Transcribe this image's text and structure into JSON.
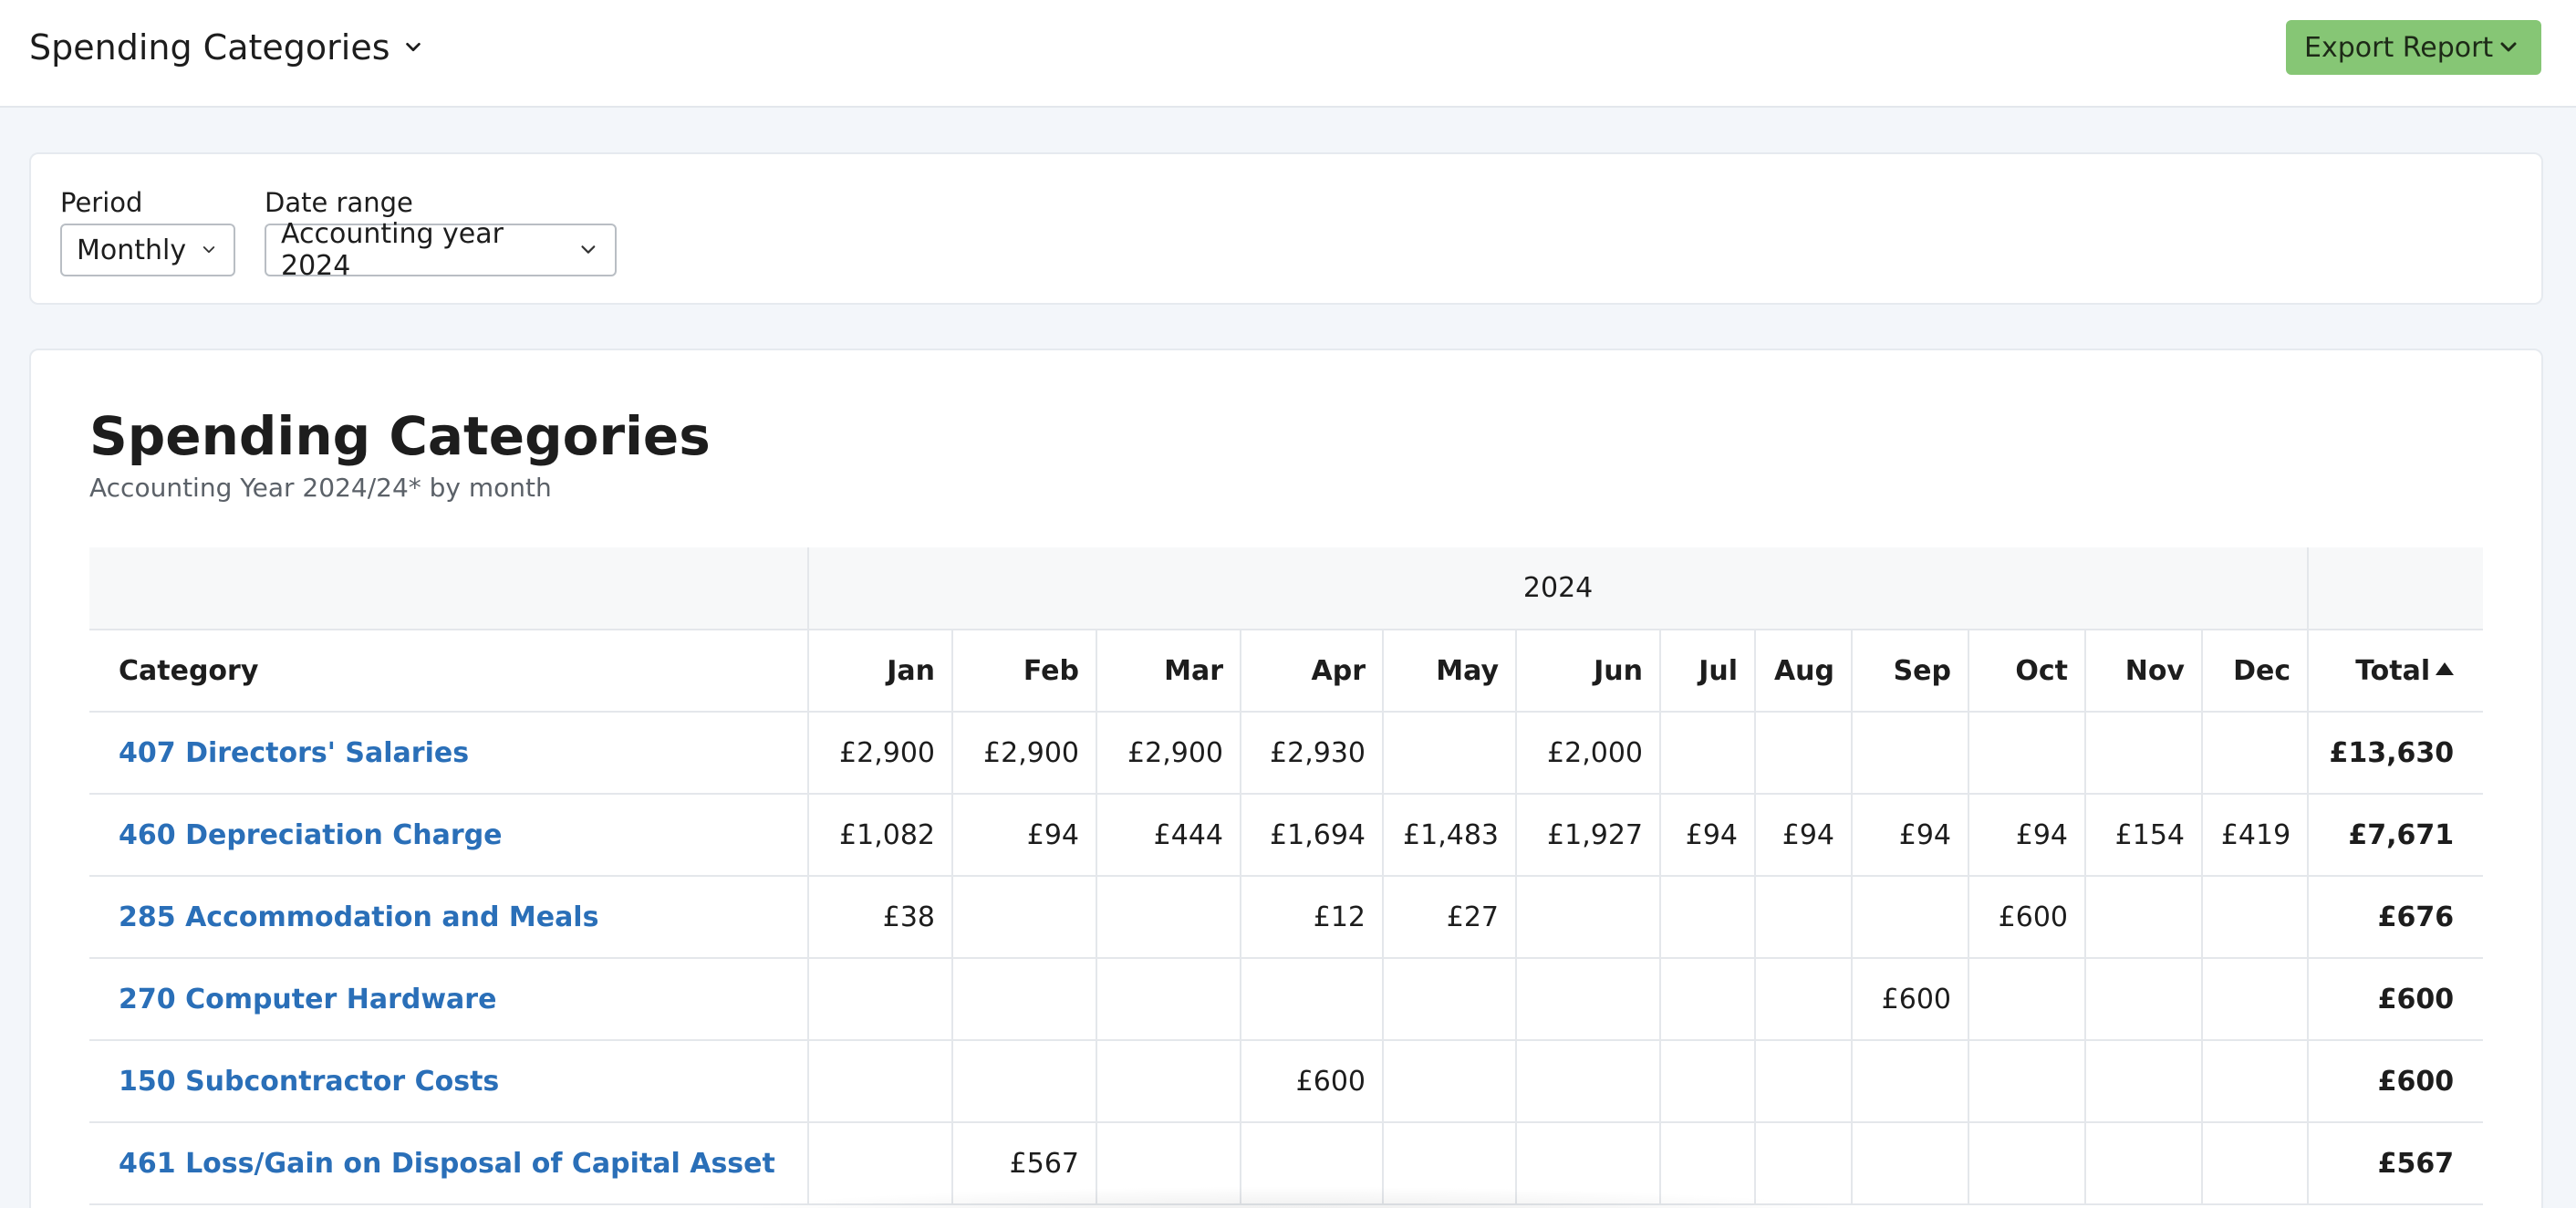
{
  "header": {
    "title": "Spending Categories",
    "export_label": "Export Report"
  },
  "filters": {
    "period_label": "Period",
    "period_value": "Monthly",
    "range_label": "Date range",
    "range_value": "Accounting year 2024"
  },
  "report": {
    "title": "Spending Categories",
    "subtitle": "Accounting Year 2024/24* by month",
    "year": "2024",
    "columns": {
      "category": "Category",
      "months": [
        "Jan",
        "Feb",
        "Mar",
        "Apr",
        "May",
        "Jun",
        "Jul",
        "Aug",
        "Sep",
        "Oct",
        "Nov",
        "Dec"
      ],
      "total": "Total"
    },
    "rows": [
      {
        "category": "407 Directors' Salaries",
        "values": [
          "£2,900",
          "£2,900",
          "£2,900",
          "£2,930",
          "",
          "£2,000",
          "",
          "",
          "",
          "",
          "",
          ""
        ],
        "total": "£13,630"
      },
      {
        "category": "460 Depreciation Charge",
        "values": [
          "£1,082",
          "£94",
          "£444",
          "£1,694",
          "£1,483",
          "£1,927",
          "£94",
          "£94",
          "£94",
          "£94",
          "£154",
          "£419"
        ],
        "total": "£7,671"
      },
      {
        "category": "285 Accommodation and Meals",
        "values": [
          "£38",
          "",
          "",
          "£12",
          "£27",
          "",
          "",
          "",
          "",
          "£600",
          "",
          ""
        ],
        "total": "£676"
      },
      {
        "category": "270 Computer Hardware",
        "values": [
          "",
          "",
          "",
          "",
          "",
          "",
          "",
          "",
          "£600",
          "",
          "",
          ""
        ],
        "total": "£600"
      },
      {
        "category": "150 Subcontractor Costs",
        "values": [
          "",
          "",
          "",
          "£600",
          "",
          "",
          "",
          "",
          "",
          "",
          "",
          ""
        ],
        "total": "£600"
      },
      {
        "category": "461 Loss/Gain on Disposal of Capital Asset",
        "values": [
          "",
          "£567",
          "",
          "",
          "",
          "",
          "",
          "",
          "",
          "",
          "",
          ""
        ],
        "total": "£567"
      }
    ]
  }
}
